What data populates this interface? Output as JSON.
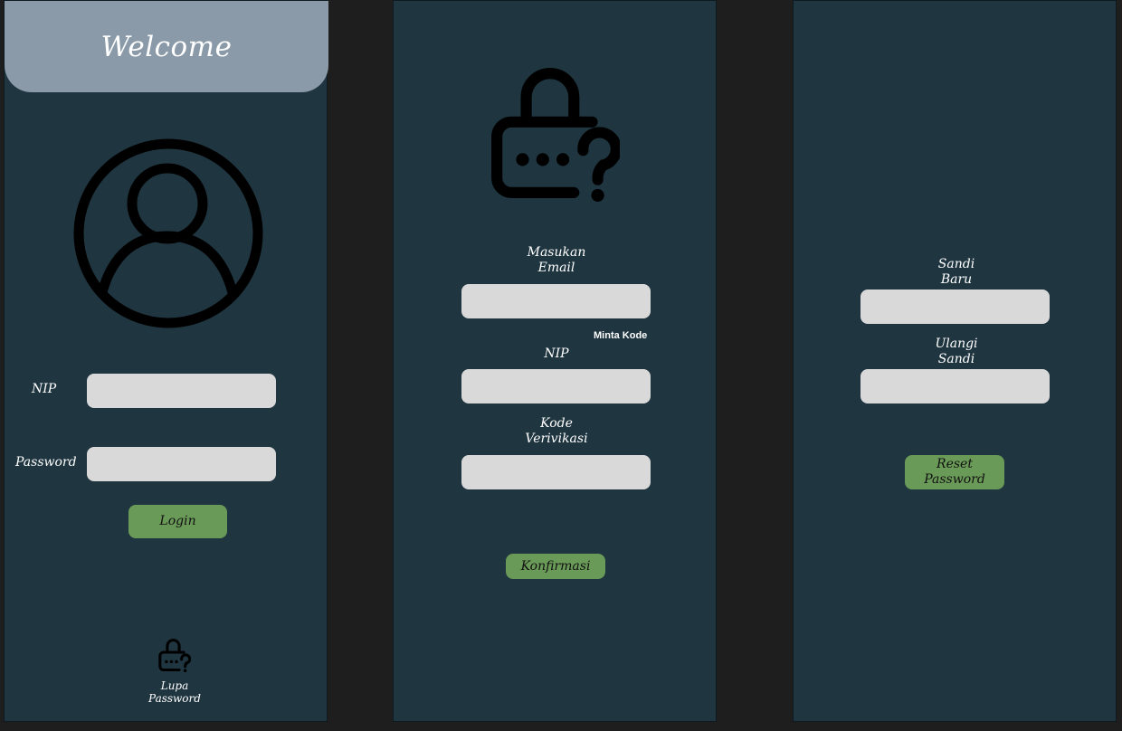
{
  "screen_login": {
    "title": "Welcome",
    "avatar_icon": "user-circle-icon",
    "nip_label": "NIP",
    "nip_value": "",
    "password_label": "Password",
    "password_value": "",
    "login_button": "Login",
    "forgot_icon": "lock-question-icon",
    "forgot_label": "Lupa\nPassword"
  },
  "screen_forgot": {
    "lock_icon": "lock-question-icon",
    "email_label": "Masukan\nEmail",
    "email_value": "",
    "request_code_link": "Minta Kode",
    "nip_label": "NIP",
    "nip_value": "",
    "code_label": "Kode\nVerivikasi",
    "code_value": "",
    "confirm_button": "Konfirmasi"
  },
  "screen_reset": {
    "new_password_label": "Sandi\nBaru",
    "new_password_value": "",
    "repeat_password_label": "Ulangi\nSandi",
    "repeat_password_value": "",
    "reset_button": "Reset\nPassword"
  },
  "colors": {
    "background": "#1e1e1e",
    "screen": "#1f3540",
    "header": "#8b9aa9",
    "field": "#d9d9d9",
    "button": "#6a9a58"
  }
}
